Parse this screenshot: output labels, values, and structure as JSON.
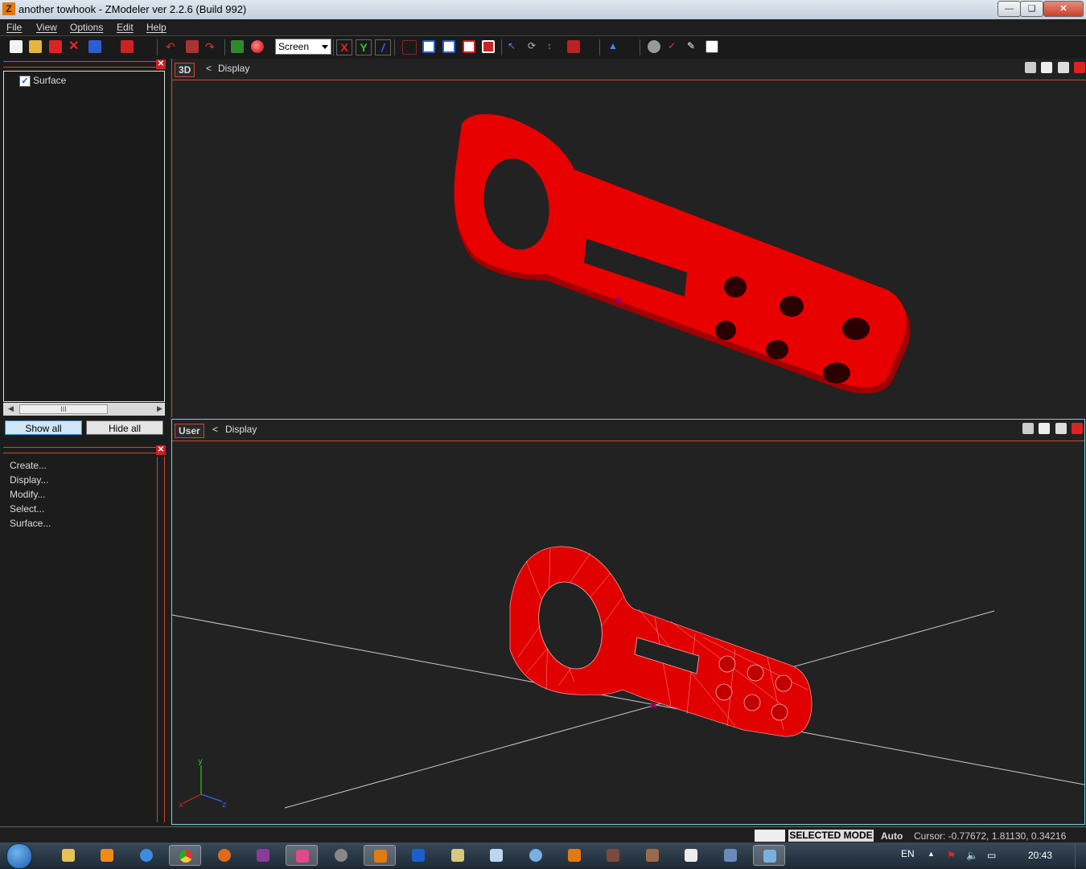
{
  "window": {
    "title": "another towhook - ZModeler ver 2.2.6 (Build 992)",
    "app_icon": "Z"
  },
  "menu": [
    "File",
    "View",
    "Options",
    "Edit",
    "Help"
  ],
  "toolbar": {
    "view_select": "Screen",
    "axis_x": "X",
    "axis_y": "Y",
    "axis_z": "Z"
  },
  "left_panel": {
    "tree_item": "Surface",
    "scroll_thumb": "III",
    "show_all": "Show all",
    "hide_all": "Hide all",
    "commands": [
      "Create...",
      "Display...",
      "Modify...",
      "Select...",
      "Surface..."
    ]
  },
  "viewports": [
    {
      "tag": "3D",
      "display": "Display",
      "back": "<"
    },
    {
      "tag": "User",
      "display": "Display",
      "back": "<"
    }
  ],
  "gizmo": {
    "x": "x",
    "y": "y",
    "z": "z"
  },
  "status": {
    "mode": "SELECTED MODE",
    "auto": "Auto",
    "cursor": "Cursor: -0.77672, 1.81130, 0.34216"
  },
  "taskbar": {
    "lang": "EN",
    "time": "20:43"
  },
  "colors": {
    "model": "#e00000",
    "accent": "#c84a2a",
    "wire": "#ff9090"
  }
}
